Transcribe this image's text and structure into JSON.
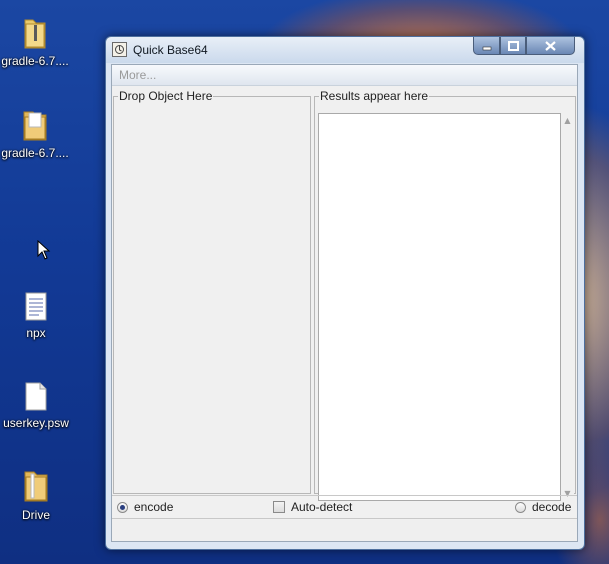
{
  "desktop": {
    "icons": [
      {
        "label": "gradle-6.7....",
        "icon": "folder-zip-icon"
      },
      {
        "label": "gradle-6.7....",
        "icon": "folder-icon"
      },
      {
        "label": "npx",
        "icon": "text-document-icon"
      },
      {
        "label": "userkey.psw",
        "icon": "blank-document-icon"
      },
      {
        "label": "Drive",
        "icon": "folder-icon"
      }
    ]
  },
  "window": {
    "title": "Quick Base64",
    "menu": {
      "more_label": "More..."
    },
    "drop_panel": {
      "legend": "Drop Object Here"
    },
    "results_panel": {
      "legend": "Results appear here",
      "content": ""
    },
    "options": {
      "encode": {
        "label": "encode",
        "checked": true
      },
      "auto_detect": {
        "label": "Auto-detect",
        "checked": false
      },
      "decode": {
        "label": "decode",
        "checked": false
      }
    },
    "status_text": ""
  },
  "colors": {
    "desktop_blue": "#123a96",
    "title_accent": "#6a87b4",
    "close_button": "#6a87b4"
  }
}
